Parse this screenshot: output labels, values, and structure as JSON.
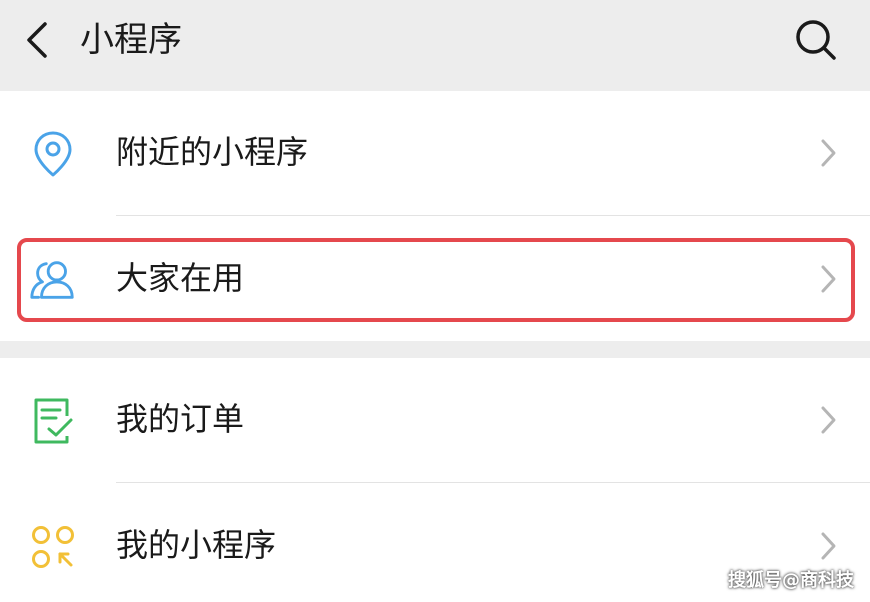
{
  "header": {
    "title": "小程序",
    "back_icon": "chevron-left-icon",
    "search_icon": "search-icon"
  },
  "groups": [
    {
      "items": [
        {
          "label": "附近的小程序",
          "icon": "location-pin-icon",
          "icon_color": "#4aa3e8"
        },
        {
          "label": "大家在用",
          "icon": "users-icon",
          "icon_color": "#4aa3e8",
          "highlighted": true
        }
      ]
    },
    {
      "items": [
        {
          "label": "我的订单",
          "icon": "order-checklist-icon",
          "icon_color": "#3fb95f"
        },
        {
          "label": "我的小程序",
          "icon": "mini-program-dots-icon",
          "icon_color": "#f2c037"
        }
      ]
    }
  ],
  "highlight_color": "#e5484d",
  "watermark": "搜狐号@商科技"
}
